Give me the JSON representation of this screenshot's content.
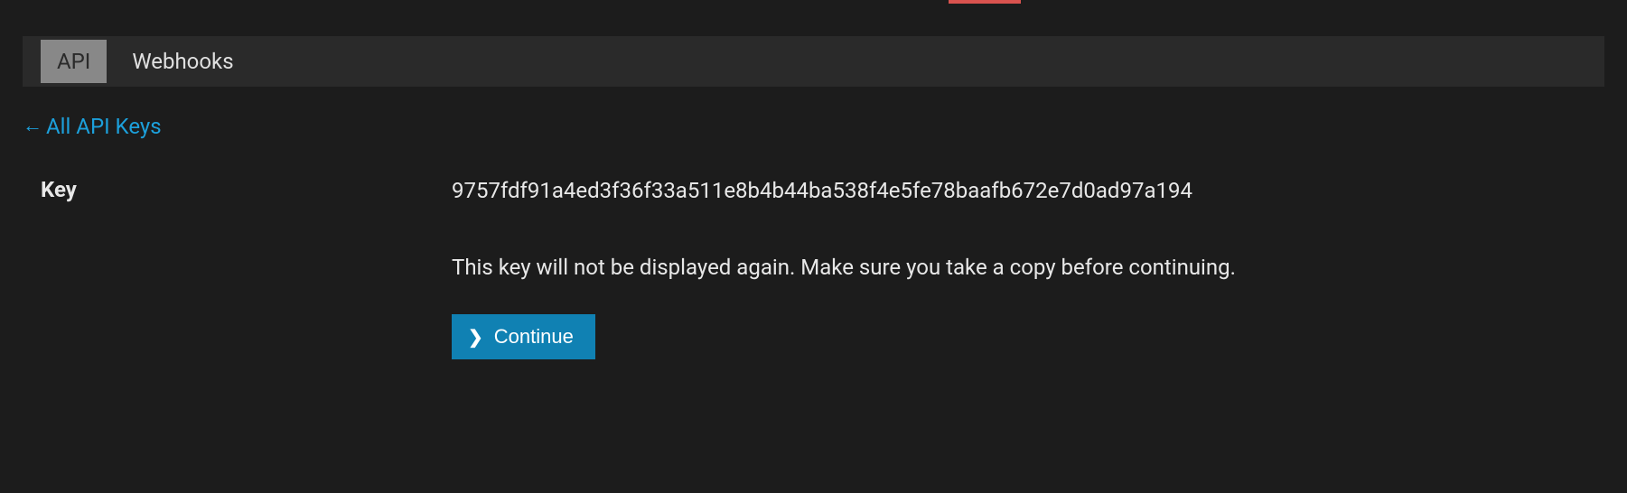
{
  "tabs": {
    "api": "API",
    "webhooks": "Webhooks"
  },
  "back_link": {
    "label": "All API Keys"
  },
  "key_section": {
    "label": "Key",
    "value": "9757fdf91a4ed3f36f33a511e8b4b44ba538f4e5fe78baafb672e7d0ad97a194",
    "warning": "This key will not be displayed again. Make sure you take a copy before continuing."
  },
  "continue_button": {
    "label": "Continue"
  }
}
